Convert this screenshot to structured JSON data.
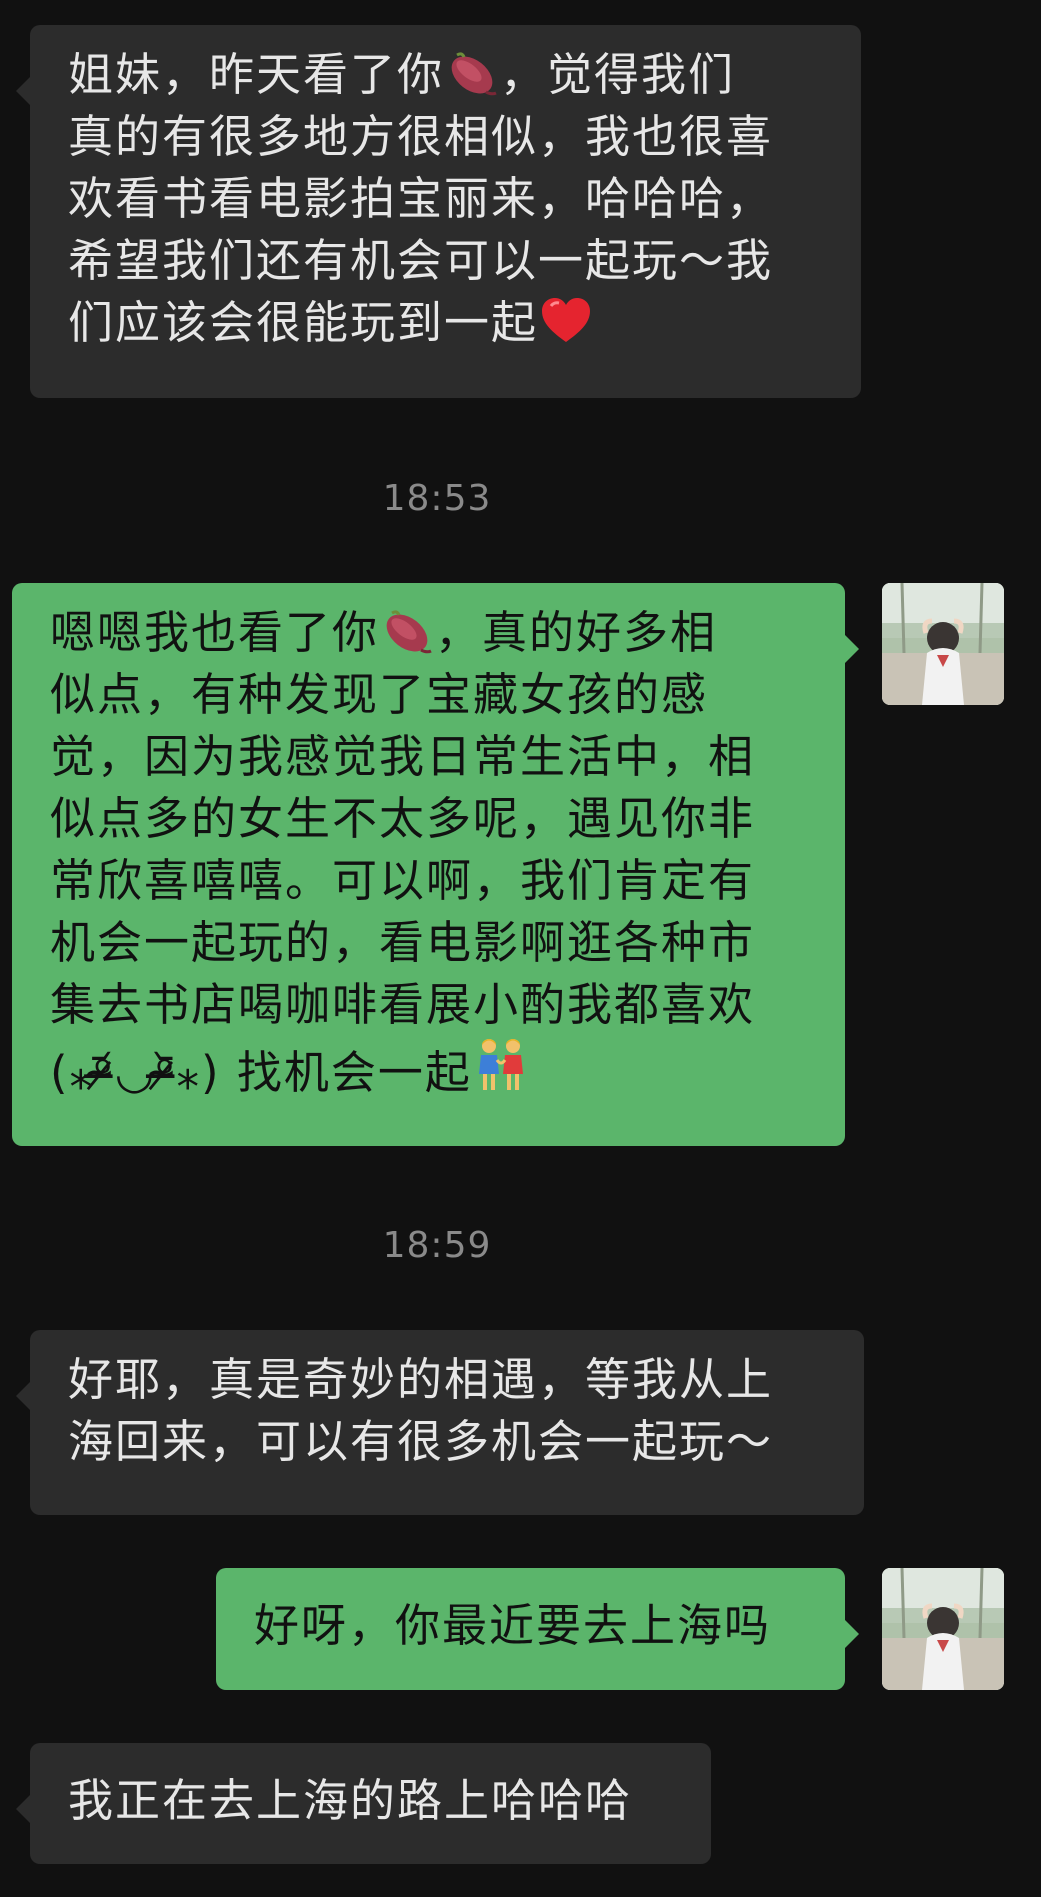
{
  "theme": {
    "background": "#111111",
    "incoming_bubble": "#2c2c2c",
    "outgoing_bubble": "#5bb56b",
    "timestamp_color": "#8a8a8a"
  },
  "messages": [
    {
      "direction": "incoming",
      "part1": "姐妹，昨天看了你",
      "emoji1": "sweet-potato-icon",
      "part2": "，觉得我们\n真的有很多地方很相似，我也很喜\n欢看书看电影拍宝丽来，哈哈哈，\n希望我们还有机会可以一起玩～我\n们应该会很能玩到一起",
      "emoji2": "red-heart-icon"
    },
    {
      "type": "timestamp",
      "text": "18:53"
    },
    {
      "direction": "outgoing",
      "part1": "嗯嗯我也看了你",
      "emoji1": "sweet-potato-icon",
      "part2": "，真的好多相\n似点，有种发现了宝藏女孩的感\n觉，因为我感觉我日常生活中，相\n似点多的女生不太多呢，遇见你非\n常欣喜嘻嘻。可以啊，我们肯定有\n机会一起玩的，看电影啊逛各种市\n集去书店喝咖啡看展小酌我都喜欢\n(⁎ᵒ̴̶̷᷄◡ᵒ̴̶̷᷅⁎) 找机会一起",
      "emoji2": "two-women-holding-hands-icon"
    },
    {
      "type": "timestamp",
      "text": "18:59"
    },
    {
      "direction": "incoming",
      "text": "好耶，真是奇妙的相遇，等我从上\n海回来，可以有很多机会一起玩～"
    },
    {
      "direction": "outgoing",
      "text": "好呀，你最近要去上海吗"
    },
    {
      "direction": "incoming",
      "text": "我正在去上海的路上哈哈哈"
    }
  ]
}
